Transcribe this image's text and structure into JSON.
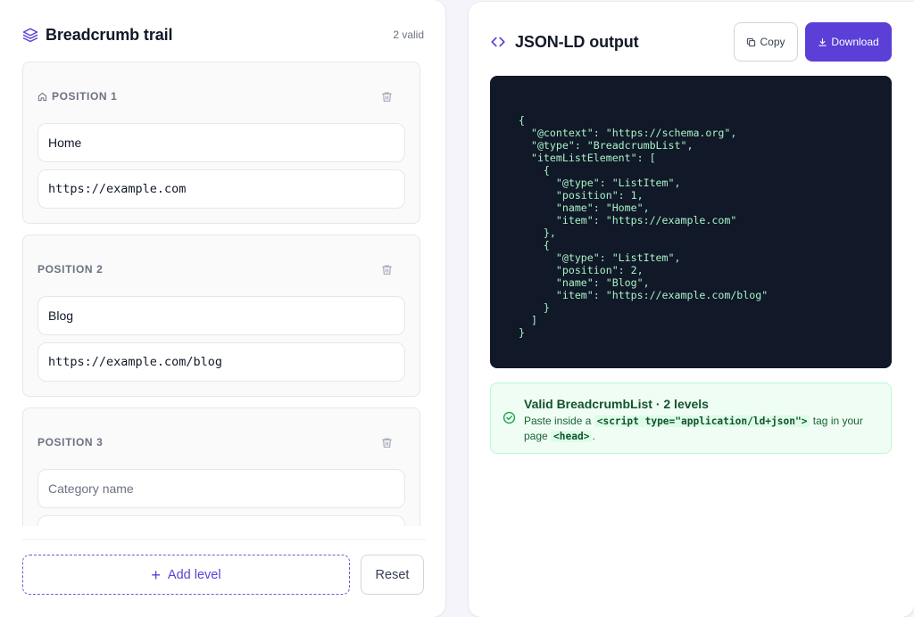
{
  "left": {
    "title": "Breadcrumb trail",
    "valid_count": "2 valid",
    "positions": [
      {
        "label": "POSITION 1",
        "name_value": "Home",
        "url_value": "https://example.com"
      },
      {
        "label": "POSITION 2",
        "name_value": "Blog",
        "url_value": "https://example.com/blog"
      },
      {
        "label": "POSITION 3",
        "name_value": "",
        "name_placeholder": "Category name",
        "url_value": ""
      }
    ],
    "add_label": "Add level",
    "reset_label": "Reset"
  },
  "right": {
    "title": "JSON-LD output",
    "copy_label": "Copy",
    "download_label": "Download",
    "code": "{\n  \"@context\": \"https://schema.org\",\n  \"@type\": \"BreadcrumbList\",\n  \"itemListElement\": [\n    {\n      \"@type\": \"ListItem\",\n      \"position\": 1,\n      \"name\": \"Home\",\n      \"item\": \"https://example.com\"\n    },\n    {\n      \"@type\": \"ListItem\",\n      \"position\": 2,\n      \"name\": \"Blog\",\n      \"item\": \"https://example.com/blog\"\n    }\n  ]\n}",
    "validation": {
      "title": "Valid BreadcrumbList · 2 levels",
      "text_before": "Paste inside a ",
      "code1": "<script type=\"application/ld+json\">",
      "text_middle": " tag in your page ",
      "code2": "<head>",
      "text_after": "."
    }
  },
  "colors": {
    "accent": "#5b3fd6",
    "code_bg": "#111827",
    "code_text": "#a7f3c8",
    "success_bg": "#f0fdf4",
    "success_text": "#14532d"
  },
  "icons": {
    "left_header": "layers-icon",
    "position_1": "home-icon",
    "delete": "trash-icon",
    "add": "plus-icon",
    "right_header": "code-icon",
    "copy": "copy-icon",
    "download": "download-icon",
    "validation": "check-circle-icon"
  }
}
